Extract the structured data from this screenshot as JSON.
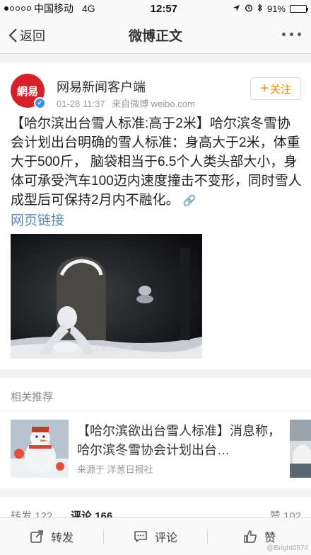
{
  "status_bar": {
    "carrier": "中国移动",
    "network": "4G",
    "time": "12:57",
    "battery": "91%",
    "battery_level": 0.91,
    "signal_dots_filled": 1,
    "signal_dots_total": 5
  },
  "nav": {
    "back_label": "返回",
    "title": "微博正文"
  },
  "post": {
    "avatar_text": "網易",
    "author": "网易新闻客户端",
    "time": "01-28 11:37",
    "source": "来自微博 weibo.com",
    "follow_label": "关注",
    "follow_plus": "+",
    "text": "【哈尔滨出台雪人标准:高于2米】哈尔滨冬雪协会计划出台明确的雪人标准：身高大于2米，体重大于500斤， 脑袋相当于6.5个人类头部大小，身体可承受汽车100迈内速度撞击不变形，同时雪人成型后可保持2月内不融化。",
    "link_label": "网页链接",
    "image_watermark": "©网易新闻客户端"
  },
  "related": {
    "title": "相关推荐",
    "item": {
      "text": "【哈尔滨欲出台雪人标准】消息称，哈尔滨冬雪协会计划出台…",
      "source": "来源于 洋葱日报社"
    }
  },
  "counts": {
    "repost_label": "转发",
    "repost_count": "122",
    "comment_label": "评论",
    "comment_count": "166",
    "like_label": "赞",
    "like_count": "102"
  },
  "toolbar": {
    "repost": "转发",
    "comment": "评论",
    "like": "赞"
  },
  "credit": "@Bright0574",
  "colors": {
    "accent_orange": "#f28b00",
    "link_blue": "#5d87b0",
    "brand_red": "#d6212b",
    "verified_blue": "#3a8ee6"
  }
}
